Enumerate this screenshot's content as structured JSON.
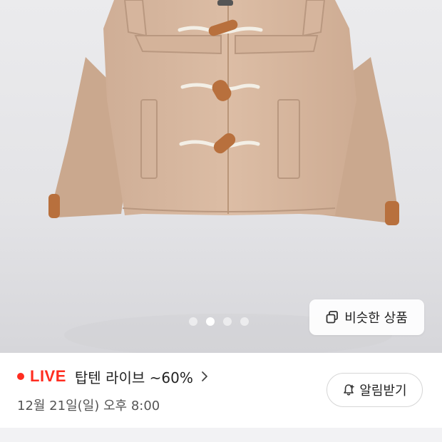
{
  "product_image": {
    "carousel": {
      "count": 4,
      "active": 2
    },
    "similar_button_label": "비슷한 상품"
  },
  "live_banner": {
    "badge": "LIVE",
    "title": "탑텐 라이브 ~60%",
    "datetime": "12월 21일(일) 오후 8:00",
    "alarm_button_label": "알림받기"
  },
  "colors": {
    "live_red": "#ff2d20",
    "coat_beige": "#d9b9a0",
    "toggle_brown": "#b8703d"
  },
  "icons": [
    "copy-icon",
    "bell-plus-icon",
    "chevron-right-icon"
  ]
}
